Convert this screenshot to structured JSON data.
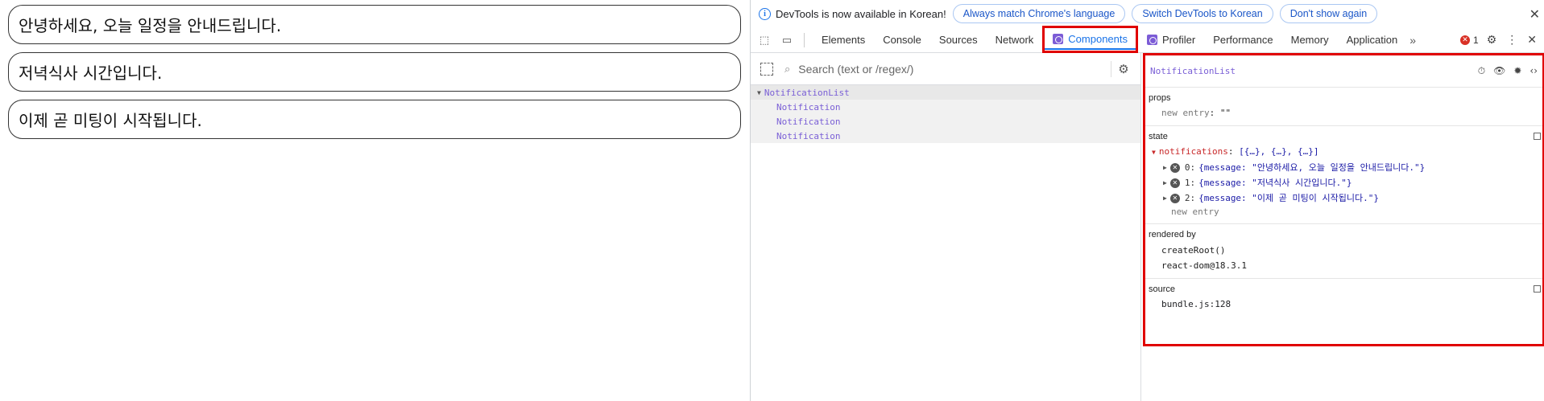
{
  "app": {
    "notifications": [
      "안녕하세요, 오늘 일정을 안내드립니다.",
      "저녁식사 시간입니다.",
      "이제 곧 미팅이 시작됩니다."
    ]
  },
  "infobar": {
    "text": "DevTools is now available in Korean!",
    "btn_match": "Always match Chrome's language",
    "btn_switch": "Switch DevTools to Korean",
    "btn_dont": "Don't show again"
  },
  "tabs": [
    "Elements",
    "Console",
    "Sources",
    "Network",
    "Components",
    "Profiler",
    "Performance",
    "Memory",
    "Application"
  ],
  "active_tab": "Components",
  "error_count": "1",
  "search": {
    "placeholder": "Search (text or /regex/)"
  },
  "tree": {
    "root": "NotificationList",
    "children": [
      "Notification",
      "Notification",
      "Notification"
    ]
  },
  "inspector": {
    "component": "NotificationList",
    "props_title": "props",
    "props_new_entry": "new entry",
    "props_new_entry_value": "\"\"",
    "state_title": "state",
    "state_key": "notifications",
    "state_summary": "[{…}, {…}, {…}]",
    "items": [
      {
        "index": "0:",
        "value": "{message: \"안녕하세요, 오늘 일정을 안내드립니다.\"}"
      },
      {
        "index": "1:",
        "value": "{message: \"저녁식사 시간입니다.\"}"
      },
      {
        "index": "2:",
        "value": "{message: \"이제 곧 미팅이 시작됩니다.\"}"
      }
    ],
    "state_new_entry": "new entry",
    "rendered_by_title": "rendered by",
    "rendered_by": [
      "createRoot()",
      "react-dom@18.3.1"
    ],
    "source_title": "source",
    "source": "bundle.js:128"
  }
}
